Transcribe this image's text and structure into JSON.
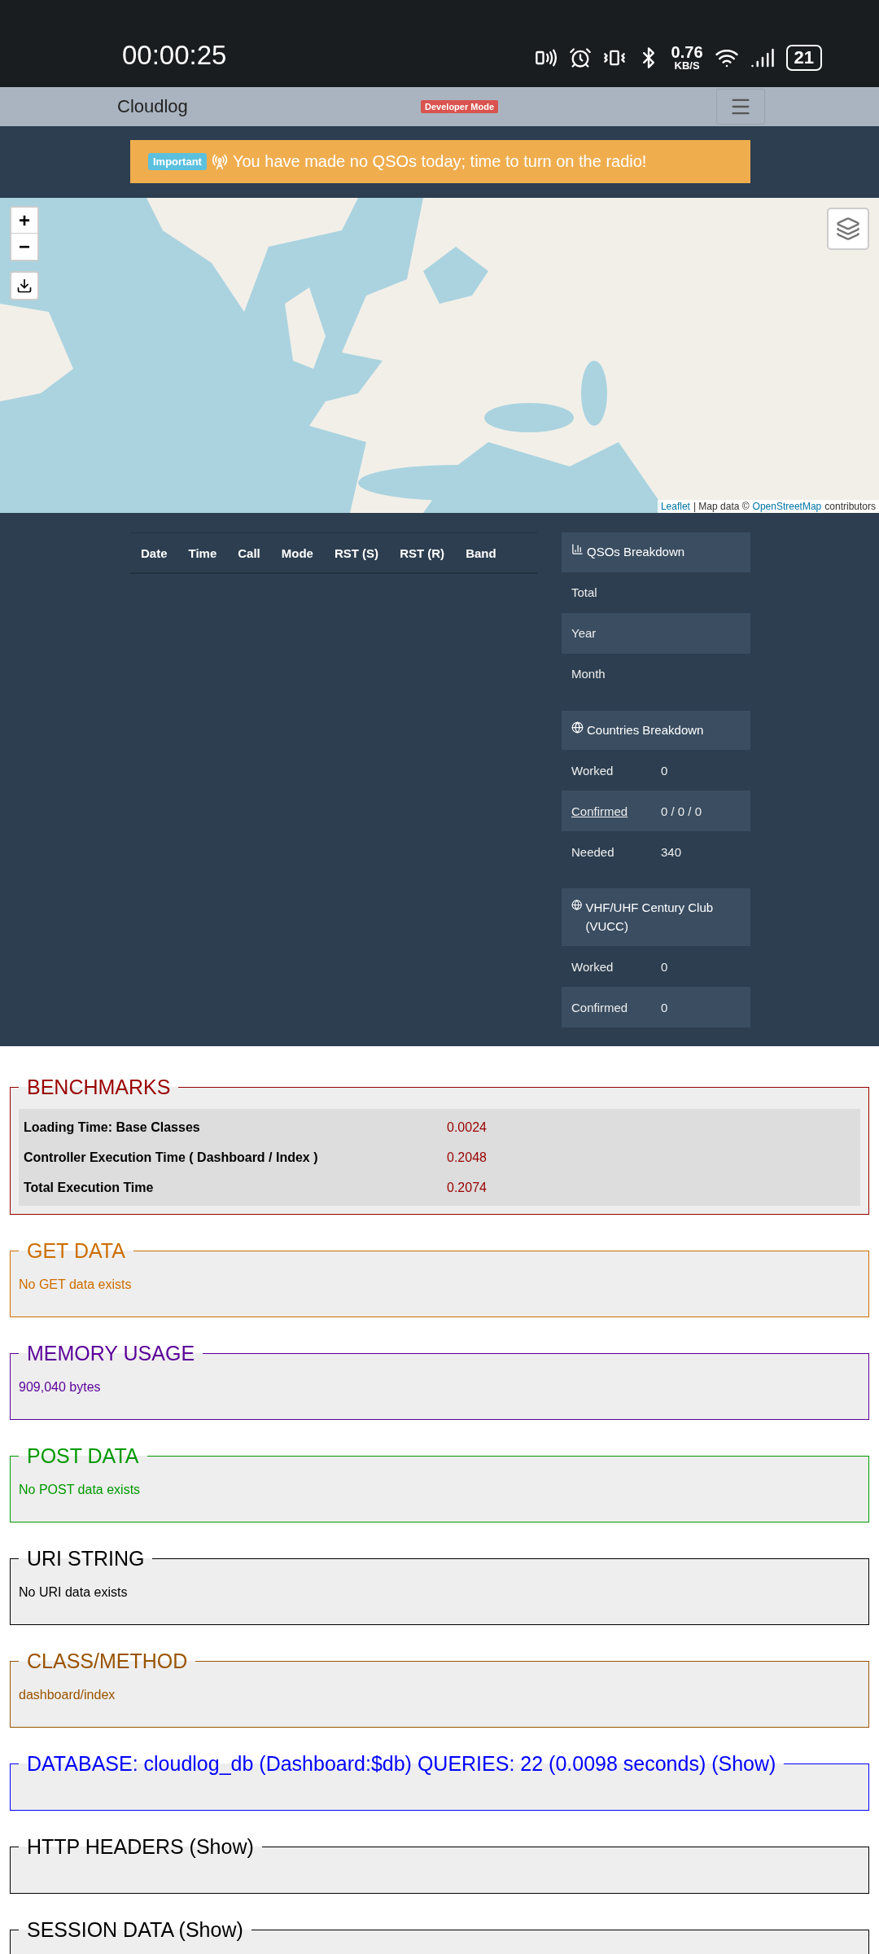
{
  "status_bar": {
    "time": "00:00:25",
    "speed": "0.76",
    "speed_unit": "KB/S",
    "battery": "21"
  },
  "navbar": {
    "brand": "Cloudlog",
    "badge": "Developer Mode"
  },
  "alert": {
    "badge": "Important",
    "message": "You have made no QSOs today; time to turn on the radio!"
  },
  "map": {
    "kind": "picture",
    "zoom_in": "+",
    "zoom_out": "−",
    "attribution_link": "Leaflet",
    "attribution_sep": "| Map data ©",
    "attribution_osm": "OpenStreetMap",
    "attribution_tail": "contributors"
  },
  "table": {
    "columns": [
      "Date",
      "Time",
      "Call",
      "Mode",
      "RST (S)",
      "RST (R)",
      "Band"
    ]
  },
  "stats": [
    {
      "title": "QSOs Breakdown",
      "rows": [
        {
          "label": "Total",
          "link": false
        },
        {
          "label": "Year",
          "link": false
        },
        {
          "label": "Month",
          "link": false
        }
      ]
    },
    {
      "title": "Countries Breakdown",
      "rows": [
        {
          "label": "Worked",
          "value": "0",
          "link": false
        },
        {
          "label": "Confirmed",
          "value": "0 / 0 / 0",
          "link": true
        },
        {
          "label": "Needed",
          "value": "340",
          "link": false
        }
      ]
    },
    {
      "title": "VHF/UHF Century Club (VUCC)",
      "rows": [
        {
          "label": "Worked",
          "value": "0",
          "link": false
        },
        {
          "label": "Confirmed",
          "value": "0",
          "link": false
        }
      ]
    }
  ],
  "profiler": [
    {
      "kind": "table",
      "title": "BENCHMARKS",
      "color": "#990000",
      "rows": [
        {
          "label": "Loading Time: Base Classes",
          "value": "0.0024"
        },
        {
          "label": "Controller Execution Time ( Dashboard / Index )",
          "value": "0.2048"
        },
        {
          "label": "Total Execution Time",
          "value": "0.2074"
        }
      ]
    },
    {
      "kind": "text",
      "title": "GET DATA",
      "color": "#cd6e00",
      "text": "No GET data exists"
    },
    {
      "kind": "text",
      "title": "MEMORY USAGE",
      "color": "#5a0099",
      "text": "909,040 bytes"
    },
    {
      "kind": "text",
      "title": "POST DATA",
      "color": "#009900",
      "text": "No POST data exists"
    },
    {
      "kind": "text",
      "title": "URI STRING",
      "color": "#000000",
      "text": "No URI data exists"
    },
    {
      "kind": "text",
      "title": "CLASS/METHOD",
      "color": "#995300",
      "text": "dashboard/index"
    },
    {
      "kind": "empty",
      "title": "DATABASE:  cloudlog_db (Dashboard:$db)   QUERIES: 22 (0.0098 seconds)",
      "show": "(Show)",
      "color": "#0000ff"
    },
    {
      "kind": "empty",
      "title": "HTTP HEADERS",
      "show": "(Show)",
      "color": "#000000"
    },
    {
      "kind": "empty",
      "title": "SESSION DATA",
      "show": "(Show)",
      "color": "#000000"
    }
  ]
}
